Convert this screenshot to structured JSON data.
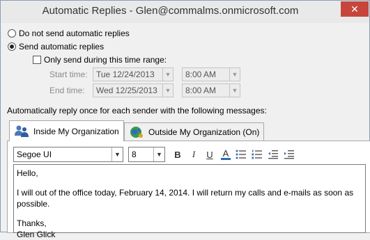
{
  "window": {
    "title": "Automatic Replies - Glen@commalms.onmicrosoft.com",
    "close_glyph": "✕"
  },
  "options": {
    "do_not_send_label": "Do not send automatic replies",
    "send_label": "Send automatic replies",
    "send_selected": true,
    "time_range_label": "Only send during this time range:",
    "start_time_label": "Start time:",
    "start_date": "Tue 12/24/2013",
    "start_hour": "8:00 AM",
    "end_time_label": "End time:",
    "end_date": "Wed 12/25/2013",
    "end_hour": "8:00 AM"
  },
  "reply_section": {
    "label": "Automatically reply once for each sender with the following messages:",
    "tabs": [
      {
        "label": "Inside My Organization",
        "icon": "people-icon",
        "active": true
      },
      {
        "label": "Outside My Organization (On)",
        "icon": "globe-icon",
        "active": false
      }
    ]
  },
  "toolbar": {
    "font_name": "Segoe UI",
    "font_size": "8",
    "bold": "B",
    "italic": "I",
    "underline": "U",
    "font_color": "A",
    "font_color_value": "#2a6db5"
  },
  "message": {
    "greeting": "Hello,",
    "body": "I will out of the office today, February 14, 2014. I will return my calls and e-mails as soon as possible.",
    "closing": "Thanks,",
    "signature": "Glen Glick"
  }
}
